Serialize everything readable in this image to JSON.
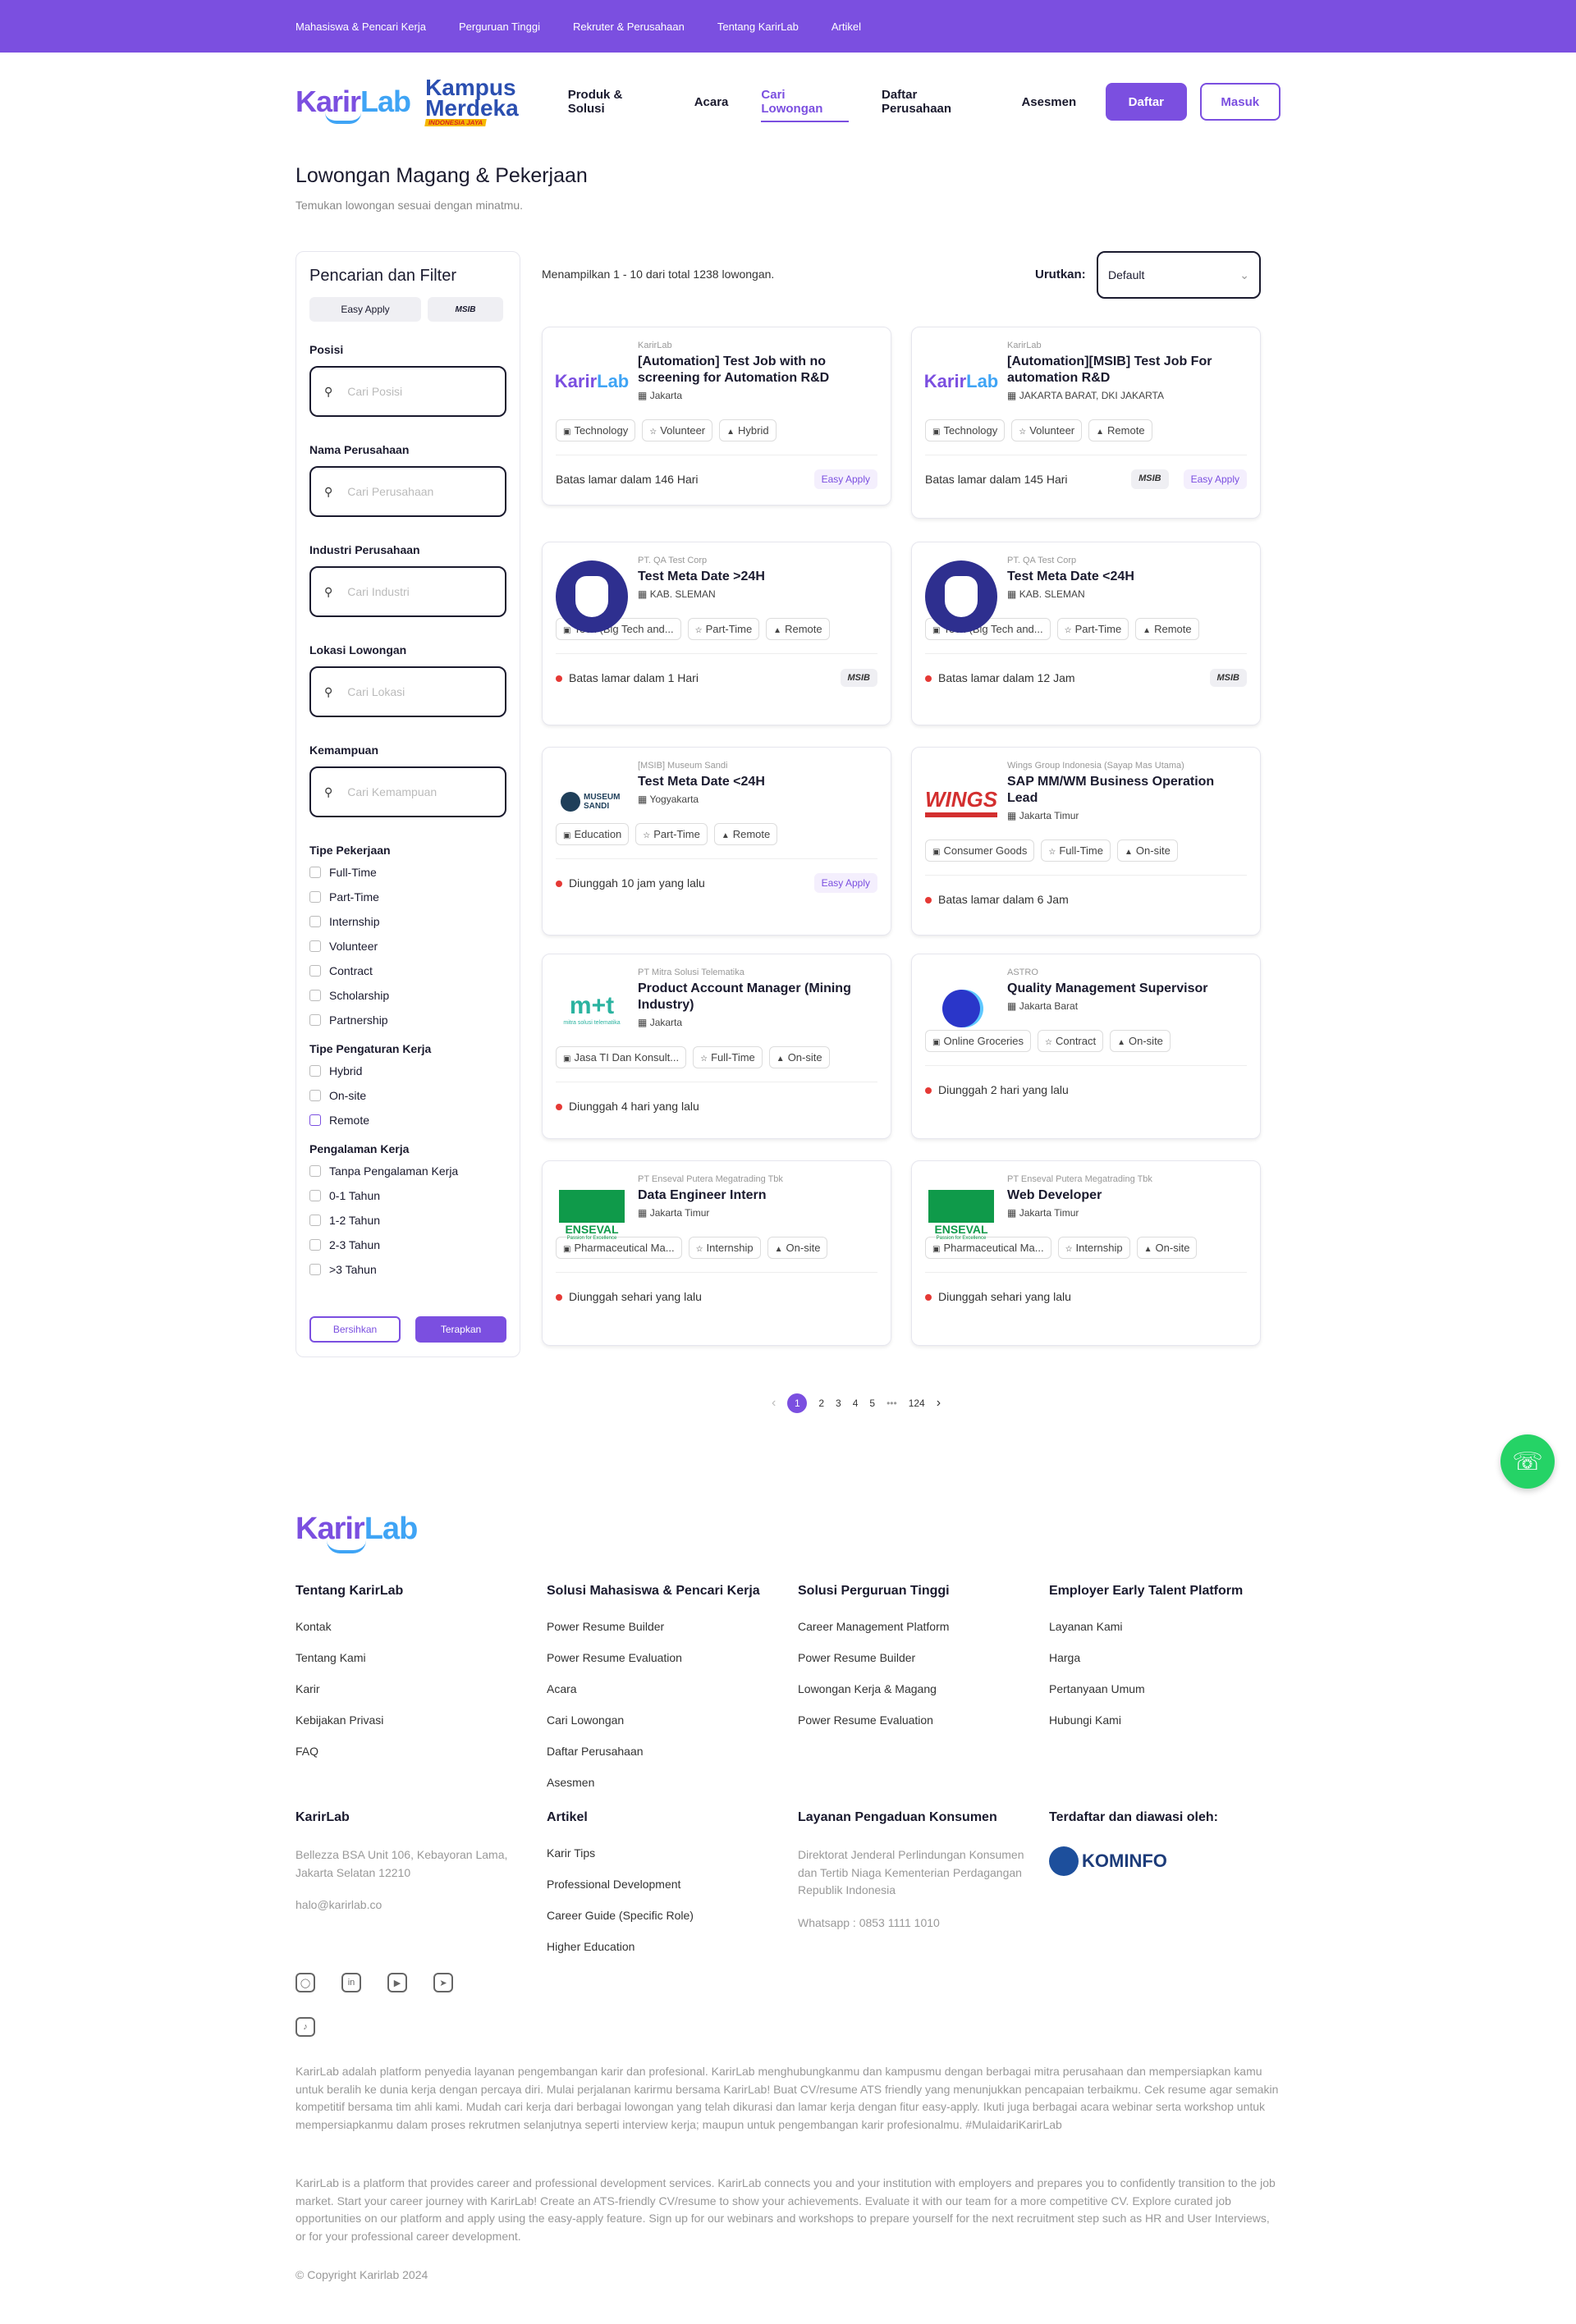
{
  "topbar": {
    "links": [
      "Mahasiswa & Pencari Kerja",
      "Perguruan Tinggi",
      "Rekruter & Perusahaan",
      "Tentang KarirLab",
      "Artikel"
    ]
  },
  "header": {
    "logo_a": "Karir",
    "logo_b": "Lab",
    "km1": "Kampus",
    "km2": "Merdeka",
    "km3": "INDONESIA JAYA",
    "nav": [
      "Produk & Solusi",
      "Acara",
      "Cari Lowongan",
      "Daftar Perusahaan",
      "Asesmen"
    ],
    "daftar": "Daftar",
    "masuk": "Masuk"
  },
  "page": {
    "title": "Lowongan Magang & Pekerjaan",
    "subtitle": "Temukan lowongan sesuai dengan minatmu."
  },
  "filter": {
    "title": "Pencarian dan Filter",
    "pill1": "Easy Apply",
    "pill2": "MSIB",
    "posisi": "Posisi",
    "posisi_ph": "Cari Posisi",
    "perusahaan": "Nama Perusahaan",
    "perusahaan_ph": "Cari Perusahaan",
    "industri": "Industri Perusahaan",
    "industri_ph": "Cari Industri",
    "lokasi": "Lokasi Lowongan",
    "lokasi_ph": "Cari Lokasi",
    "kemampuan": "Kemampuan",
    "kemampuan_ph": "Cari Kemampuan",
    "tipe_pekerjaan": "Tipe Pekerjaan",
    "tipe_pekerjaan_opts": [
      "Full-Time",
      "Part-Time",
      "Internship",
      "Volunteer",
      "Contract",
      "Scholarship",
      "Partnership"
    ],
    "tipe_pengaturan": "Tipe Pengaturan Kerja",
    "tipe_pengaturan_opts": [
      "Hybrid",
      "On-site",
      "Remote"
    ],
    "pengalaman": "Pengalaman Kerja",
    "pengalaman_opts": [
      "Tanpa Pengalaman Kerja",
      "0-1 Tahun",
      "1-2 Tahun",
      "2-3 Tahun",
      ">3 Tahun"
    ],
    "clear": "Bersihkan",
    "apply": "Terapkan"
  },
  "results": {
    "showing": "Menampilkan 1 - 10 dari total 1238 lowongan.",
    "sort_label": "Urutkan:",
    "sort_value": "Default"
  },
  "jobs": [
    {
      "company": "KarirLab",
      "title": "[Automation] Test Job with no screening for Automation R&D",
      "location": "Jakarta",
      "tags": [
        "Technology",
        "Volunteer",
        "Hybrid"
      ],
      "deadline": "Batas lamar dalam 146 Hari",
      "badges": [
        "Easy Apply"
      ]
    },
    {
      "company": "KarirLab",
      "title": "[Automation][MSIB] Test Job For automation R&D",
      "location": "JAKARTA BARAT, DKI JAKARTA",
      "tags": [
        "Technology",
        "Volunteer",
        "Remote"
      ],
      "deadline": "Batas lamar dalam 145 Hari",
      "badges": [
        "MSIB",
        "Easy Apply"
      ]
    },
    {
      "company": "PT. QA Test Corp",
      "title": "Test Meta Date >24H",
      "location": "KAB. SLEMAN",
      "tags": [
        "Tech (Big Tech and...",
        "Part-Time",
        "Remote"
      ],
      "deadline": "Batas lamar dalam 1 Hari",
      "badges": [
        "MSIB"
      ]
    },
    {
      "company": "PT. QA Test Corp",
      "title": "Test Meta Date <24H",
      "location": "KAB. SLEMAN",
      "tags": [
        "Tech (Big Tech and...",
        "Part-Time",
        "Remote"
      ],
      "deadline": "Batas lamar dalam 12 Jam",
      "badges": [
        "MSIB"
      ]
    },
    {
      "company": "[MSIB] Museum Sandi",
      "title": "Test Meta Date <24H",
      "location": "Yogyakarta",
      "tags": [
        "Education",
        "Part-Time",
        "Remote"
      ],
      "deadline": "Diunggah 10 jam yang lalu",
      "badges": [
        "Easy Apply"
      ]
    },
    {
      "company": "Wings Group Indonesia (Sayap Mas Utama)",
      "title": "SAP MM/WM Business Operation Lead",
      "location": "Jakarta Timur",
      "tags": [
        "Consumer Goods",
        "Full-Time",
        "On-site"
      ],
      "deadline": "Batas lamar dalam 6 Jam",
      "badges": []
    },
    {
      "company": "PT Mitra Solusi Telematika",
      "title": "Product Account Manager (Mining Industry)",
      "location": "Jakarta",
      "tags": [
        "Jasa TI Dan Konsult...",
        "Full-Time",
        "On-site"
      ],
      "deadline": "Diunggah 4 hari yang lalu",
      "badges": []
    },
    {
      "company": "ASTRO",
      "title": "Quality Management Supervisor",
      "location": "Jakarta Barat",
      "tags": [
        "Online Groceries",
        "Contract",
        "On-site"
      ],
      "deadline": "Diunggah 2 hari yang lalu",
      "badges": []
    },
    {
      "company": "PT Enseval Putera Megatrading Tbk",
      "title": "Data Engineer Intern",
      "location": "Jakarta Timur",
      "tags": [
        "Pharmaceutical Ma...",
        "Internship",
        "On-site"
      ],
      "deadline": "Diunggah sehari yang lalu",
      "badges": []
    },
    {
      "company": "PT Enseval Putera Megatrading Tbk",
      "title": "Web Developer",
      "location": "Jakarta Timur",
      "tags": [
        "Pharmaceutical Ma...",
        "Internship",
        "On-site"
      ],
      "deadline": "Diunggah sehari yang lalu",
      "badges": []
    }
  ],
  "logos": {
    "museum": "MUSEUM SANDI",
    "wings": "WINGS",
    "mitra": "mitra solusi telematika",
    "enseval": "ENSEVAL",
    "enseval_sub": "Passion for Excellence"
  },
  "pagination": {
    "prev": "‹",
    "pages": [
      "1",
      "2",
      "3",
      "4",
      "5"
    ],
    "ellipsis": "•••",
    "last": "124",
    "next": "›"
  },
  "footer": {
    "cols": [
      {
        "title": "Tentang KarirLab",
        "links": [
          "Kontak",
          "Tentang Kami",
          "Karir",
          "Kebijakan Privasi",
          "FAQ"
        ]
      },
      {
        "title": "Solusi Mahasiswa & Pencari Kerja",
        "links": [
          "Power Resume Builder",
          "Power Resume Evaluation",
          "Acara",
          "Cari Lowongan",
          "Daftar Perusahaan",
          "Asesmen"
        ]
      },
      {
        "title": "Solusi Perguruan Tinggi",
        "links": [
          "Career Management Platform",
          "Power Resume Builder",
          "Lowongan Kerja & Magang",
          "Power Resume Evaluation"
        ]
      },
      {
        "title": "Employer Early Talent Platform",
        "links": [
          "Layanan Kami",
          "Harga",
          "Pertanyaan Umum",
          "Hubungi Kami"
        ]
      }
    ],
    "karirlab_title": "KarirLab",
    "address": "Bellezza BSA Unit 106, Kebayoran Lama, Jakarta Selatan 12210",
    "email": "halo@karirlab.co",
    "artikel_title": "Artikel",
    "artikel_links": [
      "Karir Tips",
      "Professional Development",
      "Career Guide (Specific Role)",
      "Higher Education"
    ],
    "layanan_title": "Layanan Pengaduan Konsumen",
    "layanan_text": "Direktorat Jenderal Perlindungan Konsumen dan Tertib Niaga Kementerian Perdagangan Republik Indonesia",
    "whatsapp": "Whatsapp : 0853 1111 1010",
    "terdaftar_title": "Terdaftar dan diawasi oleh:",
    "kominfo": "KOMINFO",
    "para_id": "KarirLab adalah platform penyedia layanan pengembangan karir dan profesional. KarirLab menghubungkanmu dan kampusmu dengan berbagai mitra perusahaan dan mempersiapkan kamu untuk beralih ke dunia kerja dengan percaya diri. Mulai perjalanan karirmu bersama KarirLab! Buat CV/resume ATS friendly yang menunjukkan pencapaian terbaikmu. Cek resume agar semakin kompetitif bersama tim ahli kami. Mudah cari kerja dari berbagai lowongan yang telah dikurasi dan lamar kerja dengan fitur easy-apply. Ikuti juga berbagai acara webinar serta workshop untuk mempersiapkanmu dalam proses rekrutmen selanjutnya seperti interview kerja; maupun untuk pengembangan karir profesionalmu. #MulaidariKarirLab",
    "para_en": "KarirLab is a platform that provides career and professional development services. KarirLab connects you and your institution with employers and prepares you to confidently transition to the job market. Start your career journey with KarirLab! Create an ATS-friendly CV/resume to show your achievements. Evaluate it with our team for a more competitive CV. Explore curated job opportunities on our platform and apply using the easy-apply feature. Sign up for our webinars and workshops to prepare yourself for the next recruitment step such as HR and User Interviews, or for your professional career development.",
    "copyright": "© Copyright Karirlab 2024"
  },
  "colors": {
    "brand": "#7b4fe0",
    "accent": "#3fa4f5",
    "whatsapp": "#25d366"
  }
}
